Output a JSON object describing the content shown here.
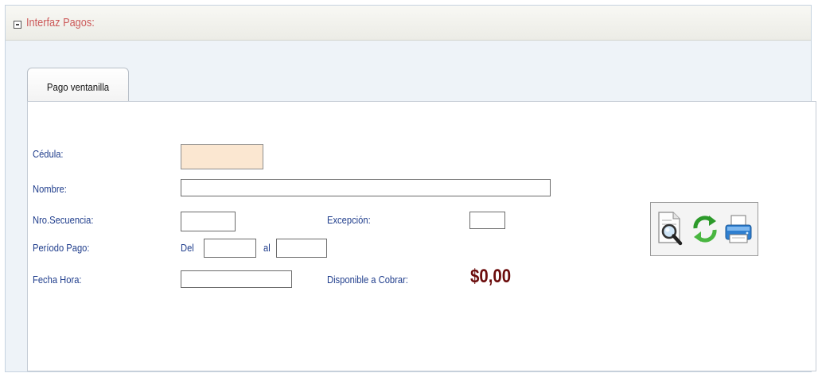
{
  "panel": {
    "title": "Interfaz Pagos:"
  },
  "tabs": [
    {
      "label": "Pago ventanilla"
    }
  ],
  "form": {
    "cedula": {
      "label": "Cédula:",
      "value": ""
    },
    "nombre": {
      "label": "Nombre:",
      "value": ""
    },
    "secuencia": {
      "label": "Nro.Secuencia:",
      "value": ""
    },
    "excepcion": {
      "label": "Excepción:",
      "value": ""
    },
    "periodo": {
      "label": "Período Pago:",
      "del_label": "Del",
      "al_label": "al",
      "del_value": "",
      "al_value": ""
    },
    "fecha_hora": {
      "label": "Fecha Hora:",
      "value": ""
    },
    "disponible": {
      "label": "Disponible a Cobrar:",
      "amount": "$0,00"
    }
  },
  "toolbar": {
    "icons": [
      "search-document-icon",
      "refresh-icon",
      "printer-icon"
    ]
  },
  "colors": {
    "label": "#1f3d8c",
    "title": "#cc5a5a",
    "amount": "#6b0c0c",
    "cedula_bg": "#fbe7d1"
  }
}
